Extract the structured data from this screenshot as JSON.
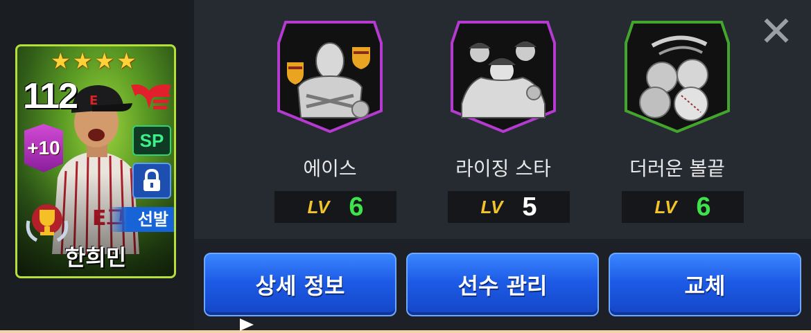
{
  "card": {
    "stars": [
      "★",
      "★",
      "★",
      "★"
    ],
    "overall": "112",
    "enhance": "+10",
    "position": "SP",
    "role": "선발",
    "name": "한희민",
    "icons": [
      "star-icon",
      "team-logo-icon",
      "lock-icon",
      "trophy-icon"
    ]
  },
  "skills": [
    {
      "name": "에이스",
      "lv_label": "LV",
      "lv_value": "6",
      "lv_color": "#3ee24a",
      "frame_color": "#b43ad0",
      "icon": "ace-emblem-icon"
    },
    {
      "name": "라이징 스타",
      "lv_label": "LV",
      "lv_value": "5",
      "lv_color": "#ffffff",
      "frame_color": "#b43ad0",
      "icon": "rising-star-emblem-icon"
    },
    {
      "name": "더러운 볼끝",
      "lv_label": "LV",
      "lv_value": "6",
      "lv_color": "#3ee24a",
      "frame_color": "#43a52c",
      "icon": "dirty-ball-emblem-icon"
    }
  ],
  "close": "✕",
  "buttons": {
    "detail": "상세 정보",
    "manage": "선수 관리",
    "swap": "교체"
  },
  "colors": {
    "button_blue": "#1d5be6",
    "card_green": "#9bd33c",
    "lv_gold": "#f2c42a"
  }
}
